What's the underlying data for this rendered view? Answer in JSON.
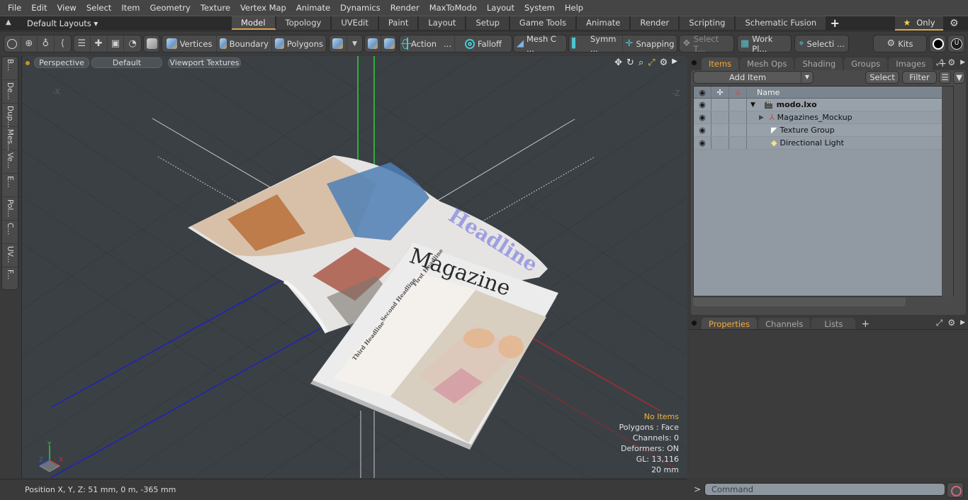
{
  "menu": [
    "File",
    "Edit",
    "View",
    "Select",
    "Item",
    "Geometry",
    "Texture",
    "Vertex Map",
    "Animate",
    "Dynamics",
    "Render",
    "MaxToModo",
    "Layout",
    "System",
    "Help"
  ],
  "layout_bar": {
    "layout_select": "Default Layouts ▾",
    "tabs": [
      "Model",
      "Topology",
      "UVEdit",
      "Paint",
      "Layout",
      "Setup",
      "Game Tools",
      "Animate",
      "Render",
      "Scripting",
      "Schematic Fusion"
    ],
    "active_tab": "Model",
    "add_tab": "+",
    "only_label": "Only"
  },
  "toolbar": {
    "vertices": "Vertices",
    "boundary": "Boundary",
    "polygons": "Polygons",
    "action": "Action",
    "falloff": "Falloff",
    "mesh": "Mesh C ...",
    "symm": "Symm ...",
    "snapping": "Snapping",
    "select_t": "Select T...",
    "work_pl": "Work Pl...",
    "selecti": "Selecti ...",
    "kits": "Kits",
    "ellipsis": "..."
  },
  "left_tabs": [
    "B...",
    "De...",
    "Dup...",
    "Mes...",
    "Ve...",
    "E...",
    "Pol...",
    "C...",
    "UV...",
    "F..."
  ],
  "viewport": {
    "view_mode": "Perspective",
    "shading": "Default",
    "textures": "Viewport Textures",
    "axis_neg_x": "-X",
    "axis_neg_z": "-Z",
    "gizmo": {
      "x": "X",
      "y": "Y",
      "z": "Z"
    },
    "info": {
      "selection": "No Items",
      "polygons": "Polygons : Face",
      "channels": "Channels: 0",
      "deformers": "Deformers: ON",
      "gl": "GL: 13,116",
      "grid": "20 mm"
    }
  },
  "status": {
    "position": "Position X, Y, Z:   51 mm, 0 m, -365 mm"
  },
  "items_panel": {
    "tabs": [
      "Items",
      "Mesh Ops",
      "Shading",
      "Groups",
      "Images"
    ],
    "active_tab": "Items",
    "add_item": "Add Item",
    "select": "Select",
    "filter": "Filter",
    "column_name": "Name",
    "tree": [
      {
        "name": "modo.lxo",
        "depth": 0,
        "icon": "scene-clapper-icon",
        "expanded": true,
        "bold": true
      },
      {
        "name": "Magazines_Mockup",
        "depth": 1,
        "icon": "locator-axes-icon",
        "expanded": false
      },
      {
        "name": "Texture Group",
        "depth": 1,
        "icon": "texture-group-icon"
      },
      {
        "name": "Directional Light",
        "depth": 1,
        "icon": "light-icon"
      }
    ]
  },
  "properties_panel": {
    "tabs": [
      "Properties",
      "Channels",
      "Lists"
    ],
    "active_tab": "Properties"
  },
  "command": {
    "prompt": ">",
    "placeholder": "Command"
  },
  "colors": {
    "accent": "#e0a34a",
    "active_tab_text": "#f0a83a",
    "axis_x": "#c0262b",
    "axis_y": "#2ed13c",
    "axis_z": "#1e22b8",
    "info_warning": "#f0b43c"
  }
}
